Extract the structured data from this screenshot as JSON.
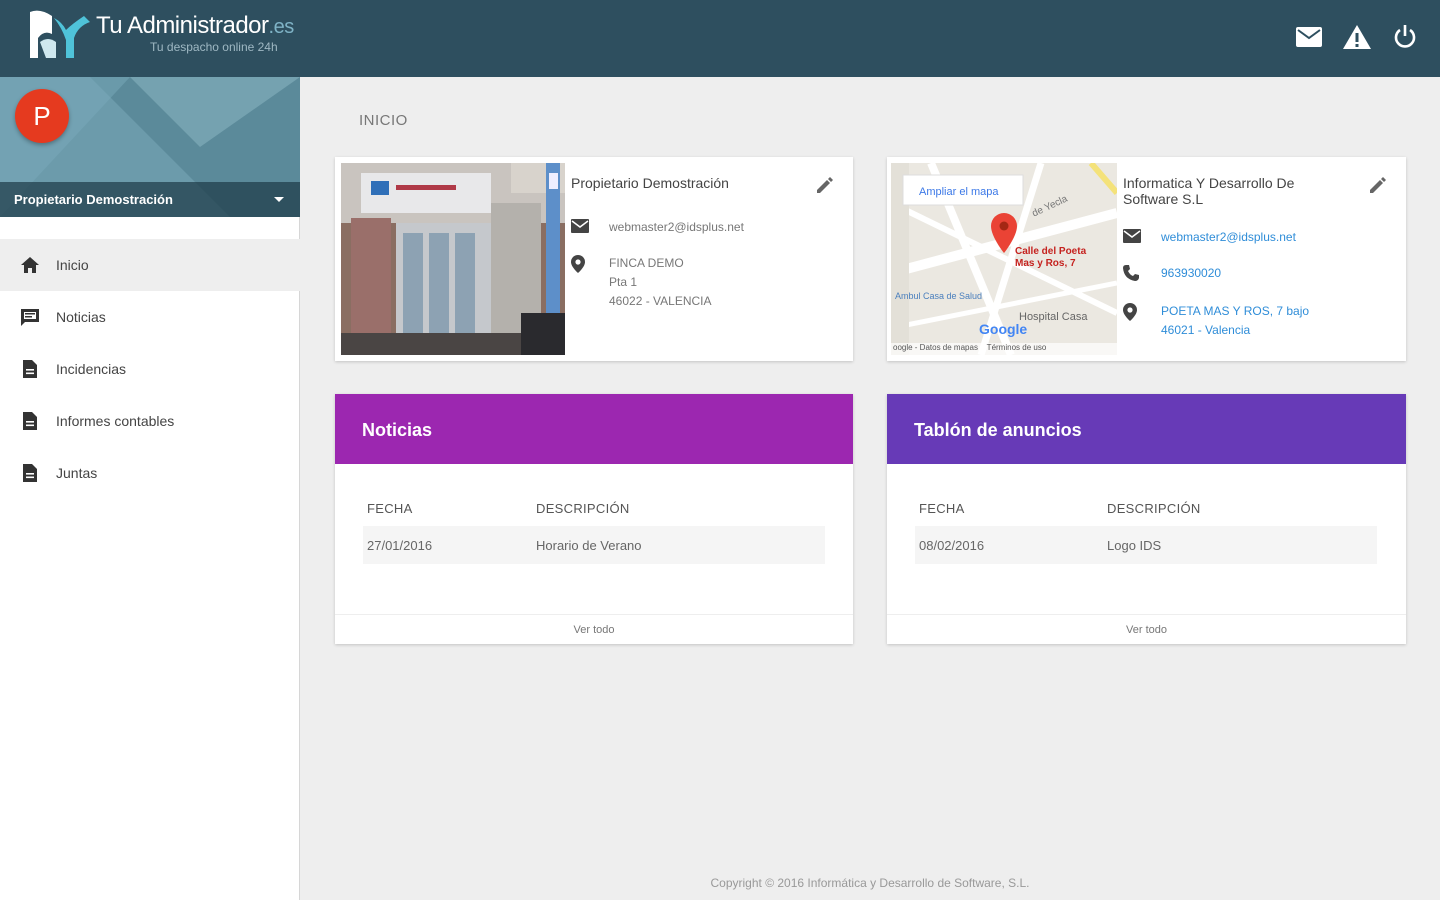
{
  "header": {
    "logo_title": "Tu Administrador",
    "logo_suffix": ".es",
    "logo_subtitle": "Tu despacho online 24h",
    "icons": [
      "mail-icon",
      "warning-icon",
      "power-icon"
    ]
  },
  "sidebar": {
    "avatar_letter": "P",
    "user_name": "Propietario Demostración",
    "items": [
      {
        "label": "Inicio",
        "icon": "home-icon",
        "active": true
      },
      {
        "label": "Noticias",
        "icon": "chat-icon"
      },
      {
        "label": "Incidencias",
        "icon": "document-icon"
      },
      {
        "label": "Informes contables",
        "icon": "document-icon"
      },
      {
        "label": "Juntas",
        "icon": "document-icon"
      }
    ]
  },
  "main": {
    "title": "INICIO",
    "owner_card": {
      "name": "Propietario Demostración",
      "email": "webmaster2@idsplus.net",
      "address_lines": [
        "FINCA DEMO",
        "Pta 1",
        "46022 - VALENCIA"
      ]
    },
    "admin_card": {
      "name": "Informatica Y Desarrollo De Software S.L",
      "email": "webmaster2@idsplus.net",
      "phone": "963930020",
      "address_lines": [
        "POETA MAS Y ROS, 7 bajo",
        "46021 - Valencia"
      ],
      "map": {
        "enlarge_label": "Ampliar el mapa",
        "pin_label_line1": "Calle del Poeta",
        "pin_label_line2": "Mas y Ros, 7",
        "street_label": "de Yecla",
        "place1": "Ambul Casa de Salud",
        "place2": "Hospital Casa",
        "brand": "Google",
        "footer": "oogle - Datos de mapas    Términos de uso"
      }
    },
    "news_panel": {
      "title": "Noticias",
      "col_date": "FECHA",
      "col_desc": "DESCRIPCIÓN",
      "rows": [
        {
          "date": "27/01/2016",
          "desc": "Horario de Verano"
        }
      ],
      "footer": "Ver todo"
    },
    "board_panel": {
      "title": "Tablón de anuncios",
      "col_date": "FECHA",
      "col_desc": "DESCRIPCIÓN",
      "rows": [
        {
          "date": "08/02/2016",
          "desc": "Logo IDS"
        }
      ],
      "footer": "Ver todo"
    },
    "copyright": "Copyright © 2016 Informática y Desarrollo de Software, S.L."
  },
  "colors": {
    "topbar": "#2e4f5f",
    "news_header": "#9c27b0",
    "board_header": "#673ab7",
    "avatar": "#e53a1f",
    "link": "#2f8dd8"
  }
}
